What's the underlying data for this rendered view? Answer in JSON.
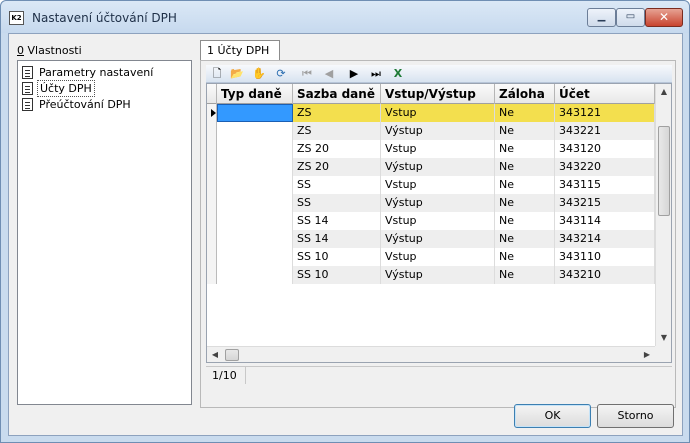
{
  "window": {
    "title": "Nastavení účtování DPH",
    "app_icon_text": "K2"
  },
  "left_panel": {
    "label_prefix": "0",
    "label_rest": " Vlastnosti",
    "items": [
      {
        "label": "Parametry nastavení"
      },
      {
        "label": "Účty DPH"
      },
      {
        "label": "Přeúčtování DPH"
      }
    ]
  },
  "tab": {
    "label": "1 Účty DPH"
  },
  "toolbar": {
    "icons": [
      "new-icon",
      "open-icon",
      "hand-icon",
      "refresh-icon",
      "first-icon",
      "prev-icon",
      "next-icon",
      "last-icon",
      "excel-icon"
    ]
  },
  "grid": {
    "columns": [
      "Typ daně",
      "Sazba daně",
      "Vstup/Výstup",
      "Záloha",
      "Účet"
    ],
    "rows": [
      [
        "",
        "ZS",
        "Vstup",
        "Ne",
        "343121"
      ],
      [
        "",
        "ZS",
        "Výstup",
        "Ne",
        "343221"
      ],
      [
        "",
        "ZS 20",
        "Vstup",
        "Ne",
        "343120"
      ],
      [
        "",
        "ZS 20",
        "Výstup",
        "Ne",
        "343220"
      ],
      [
        "",
        "SS",
        "Vstup",
        "Ne",
        "343115"
      ],
      [
        "",
        "SS",
        "Výstup",
        "Ne",
        "343215"
      ],
      [
        "",
        "SS 14",
        "Vstup",
        "Ne",
        "343114"
      ],
      [
        "",
        "SS 14",
        "Výstup",
        "Ne",
        "343214"
      ],
      [
        "",
        "SS 10",
        "Vstup",
        "Ne",
        "343110"
      ],
      [
        "",
        "SS 10",
        "Výstup",
        "Ne",
        "343210"
      ]
    ]
  },
  "status": {
    "position": "1/10"
  },
  "buttons": {
    "ok": "OK",
    "cancel": "Storno"
  }
}
